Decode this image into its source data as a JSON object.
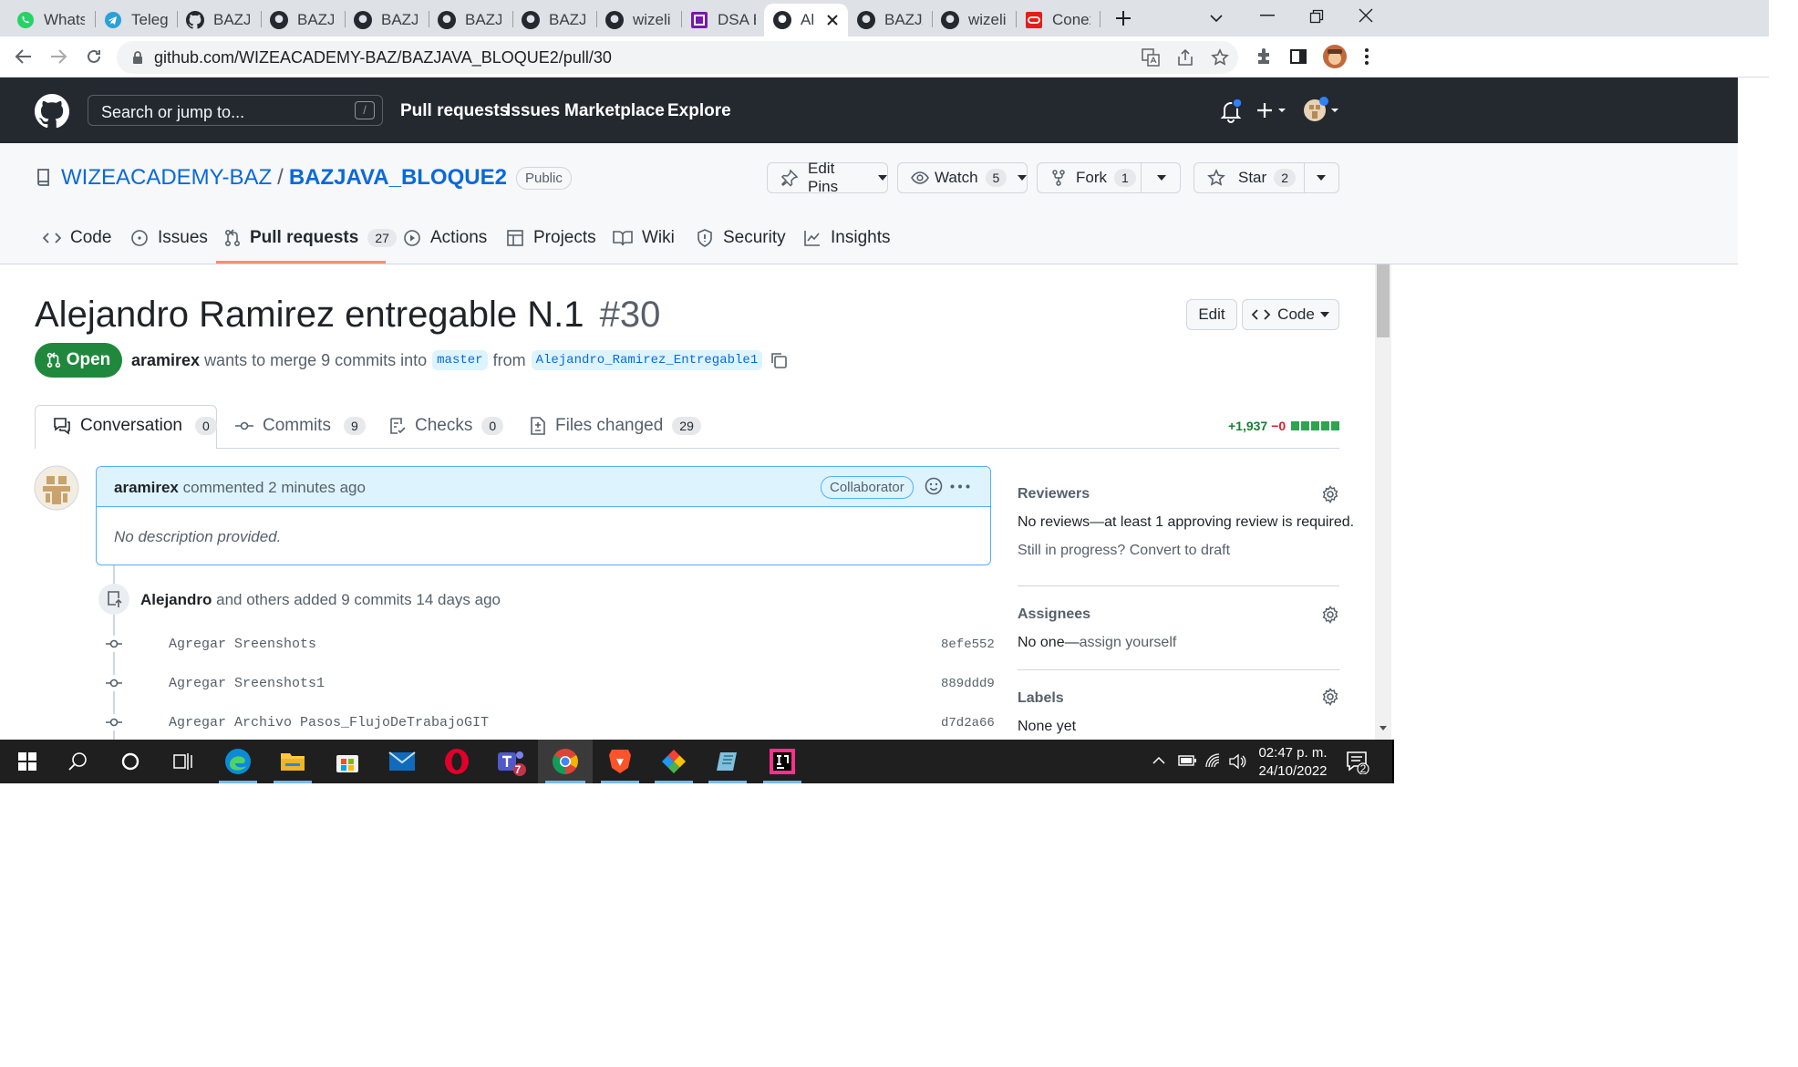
{
  "browser": {
    "tabs": [
      {
        "label": "Whats/",
        "icon": "whatsapp-icon"
      },
      {
        "label": "Telegra",
        "icon": "telegram-icon"
      },
      {
        "label": "BAZJA\\",
        "icon": "github-icon"
      },
      {
        "label": "BAZJA\\",
        "icon": "github-icon"
      },
      {
        "label": "BAZJA\\",
        "icon": "github-icon"
      },
      {
        "label": "BAZJA\\",
        "icon": "github-icon"
      },
      {
        "label": "BAZJA\\",
        "icon": "github-icon"
      },
      {
        "label": "wizelin",
        "icon": "github-icon"
      },
      {
        "label": "DSA B/",
        "icon": "onenote-icon"
      },
      {
        "label": "Ale",
        "icon": "github-icon",
        "active": true
      },
      {
        "label": "BAZJA\\",
        "icon": "github-icon"
      },
      {
        "label": "wizelin",
        "icon": "github-icon"
      },
      {
        "label": "Conexi",
        "icon": "oracle-icon"
      }
    ],
    "url": "github.com/WIZEACADEMY-BAZ/BAZJAVA_BLOQUE2/pull/30"
  },
  "github": {
    "search_placeholder": "Search or jump to...",
    "search_kbd": "/",
    "nav": [
      "Pull requests",
      "Issues",
      "Marketplace",
      "Explore"
    ]
  },
  "repo": {
    "owner": "WIZEACADEMY-BAZ",
    "sep": "/",
    "name": "BAZJAVA_BLOQUE2",
    "visibility": "Public",
    "edit_pins": "Edit Pins",
    "watch": "Watch",
    "watch_count": "5",
    "fork": "Fork",
    "fork_count": "1",
    "star": "Star",
    "star_count": "2",
    "tabs": {
      "code": "Code",
      "issues": "Issues",
      "pulls": "Pull requests",
      "pulls_count": "27",
      "actions": "Actions",
      "projects": "Projects",
      "wiki": "Wiki",
      "security": "Security",
      "insights": "Insights"
    }
  },
  "pr": {
    "title": "Alejandro Ramirez entregable N.1",
    "number": "#30",
    "edit": "Edit",
    "code": "Code",
    "state": "Open",
    "author": "aramirex",
    "merge_text": "wants to merge 9 commits into",
    "base": "master",
    "from_word": "from",
    "head": "Alejandro_Ramirez_Entregable1",
    "tabs": {
      "conversation": "Conversation",
      "conversation_count": "0",
      "commits": "Commits",
      "commits_count": "9",
      "checks": "Checks",
      "checks_count": "0",
      "files": "Files changed",
      "files_count": "29"
    },
    "additions": "+1,937",
    "deletions": "−0",
    "comment": {
      "author": "aramirex",
      "meta": "commented 2 minutes ago",
      "role": "Collaborator",
      "body": "No description provided."
    },
    "commits_event": {
      "author": "Alejandro",
      "text": "and others added 9 commits 14 days ago"
    },
    "commits": [
      {
        "message": "Agregar Sreenshots",
        "sha": "8efe552"
      },
      {
        "message": "Agregar Sreenshots1",
        "sha": "889ddd9"
      },
      {
        "message": "Agregar Archivo Pasos_FlujoDeTrabajoGIT",
        "sha": "d7d2a66"
      }
    ]
  },
  "sidebar": {
    "reviewers_title": "Reviewers",
    "reviewers_text": "No reviews—at least 1 approving review is required.",
    "progress_text": "Still in progress?",
    "convert_link": "Convert to draft",
    "assignees_title": "Assignees",
    "assignees_text": "No one—",
    "assign_link": "assign yourself",
    "labels_title": "Labels",
    "labels_text": "None yet"
  },
  "taskbar": {
    "time": "02:47 p. m.",
    "date": "24/10/2022",
    "notifications": "2",
    "teams_badge": "7"
  },
  "colors": {
    "accent": "#0969da",
    "open_green": "#1f883d",
    "header_dark": "#24292f",
    "underline": "#fd8c73"
  }
}
